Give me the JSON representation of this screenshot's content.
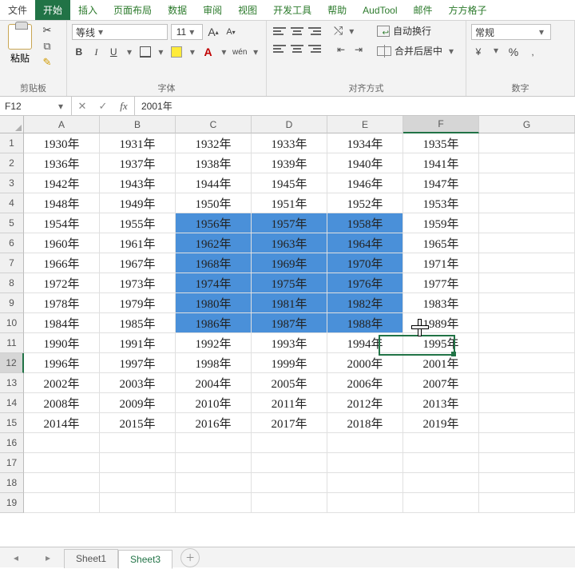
{
  "tabs": [
    "文件",
    "开始",
    "插入",
    "页面布局",
    "数据",
    "审阅",
    "视图",
    "开发工具",
    "帮助",
    "AudTool",
    "邮件",
    "方方格子"
  ],
  "active_tab_index": 1,
  "ribbon": {
    "clipboard": {
      "paste": "粘贴",
      "title": "剪贴板"
    },
    "font": {
      "name": "等线",
      "size": "11",
      "title": "字体",
      "aa_big": "A",
      "aa_small": "A",
      "b": "B",
      "i": "I",
      "u": "U",
      "wen": "wén"
    },
    "align": {
      "title": "对齐方式",
      "wrap": "自动换行",
      "merge": "合并后居中"
    },
    "number": {
      "title": "数字",
      "format": "常规",
      "pct": "%",
      "comma": ","
    }
  },
  "namebox": "F12",
  "formula": "2001年",
  "columns": [
    "A",
    "B",
    "C",
    "D",
    "E",
    "F",
    "G"
  ],
  "sel_col_index": 5,
  "sel_row_index": 11,
  "rows": [
    [
      "1930年",
      "1931年",
      "1932年",
      "1933年",
      "1934年",
      "1935年",
      ""
    ],
    [
      "1936年",
      "1937年",
      "1938年",
      "1939年",
      "1940年",
      "1941年",
      ""
    ],
    [
      "1942年",
      "1943年",
      "1944年",
      "1945年",
      "1946年",
      "1947年",
      ""
    ],
    [
      "1948年",
      "1949年",
      "1950年",
      "1951年",
      "1952年",
      "1953年",
      ""
    ],
    [
      "1954年",
      "1955年",
      "1956年",
      "1957年",
      "1958年",
      "1959年",
      ""
    ],
    [
      "1960年",
      "1961年",
      "1962年",
      "1963年",
      "1964年",
      "1965年",
      ""
    ],
    [
      "1966年",
      "1967年",
      "1968年",
      "1969年",
      "1970年",
      "1971年",
      ""
    ],
    [
      "1972年",
      "1973年",
      "1974年",
      "1975年",
      "1976年",
      "1977年",
      ""
    ],
    [
      "1978年",
      "1979年",
      "1980年",
      "1981年",
      "1982年",
      "1983年",
      ""
    ],
    [
      "1984年",
      "1985年",
      "1986年",
      "1987年",
      "1988年",
      "1989年",
      ""
    ],
    [
      "1990年",
      "1991年",
      "1992年",
      "1993年",
      "1994年",
      "1995年",
      ""
    ],
    [
      "1996年",
      "1997年",
      "1998年",
      "1999年",
      "2000年",
      "2001年",
      ""
    ],
    [
      "2002年",
      "2003年",
      "2004年",
      "2005年",
      "2006年",
      "2007年",
      ""
    ],
    [
      "2008年",
      "2009年",
      "2010年",
      "2011年",
      "2012年",
      "2013年",
      ""
    ],
    [
      "2014年",
      "2015年",
      "2016年",
      "2017年",
      "2018年",
      "2019年",
      ""
    ],
    [
      "",
      "",
      "",
      "",
      "",
      "",
      ""
    ],
    [
      "",
      "",
      "",
      "",
      "",
      "",
      ""
    ],
    [
      "",
      "",
      "",
      "",
      "",
      "",
      ""
    ],
    [
      "",
      "",
      "",
      "",
      "",
      "",
      ""
    ]
  ],
  "blue_range": {
    "r0": 4,
    "r1": 9,
    "c0": 2,
    "c1": 4
  },
  "sheet_tabs": [
    "Sheet1",
    "Sheet3"
  ],
  "active_sheet_index": 1
}
